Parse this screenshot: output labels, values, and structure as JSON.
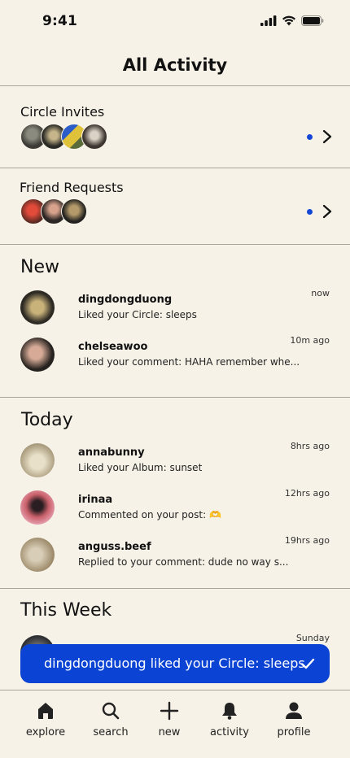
{
  "status_bar": {
    "time": "9:41"
  },
  "page_title": "All Activity",
  "circle_invites": {
    "label": "Circle Invites",
    "unread": true
  },
  "friend_requests": {
    "label": "Friend Requests",
    "unread": true
  },
  "sections": {
    "new": {
      "title": "New",
      "items": [
        {
          "user": "dingdongduong",
          "text": "Liked your Circle: sleeps",
          "time": "now"
        },
        {
          "user": "chelseawoo",
          "text": "Liked your comment: HAHA remember whe...",
          "time": "10m ago"
        }
      ]
    },
    "today": {
      "title": "Today",
      "items": [
        {
          "user": "annabunny",
          "text": "Liked your Album: sunset",
          "time": "8hrs ago"
        },
        {
          "user": "irinaa",
          "text": "Commented on your post: 🫶",
          "time": "12hrs ago"
        },
        {
          "user": "anguss.beef",
          "text": "Replied to your comment: dude no way s...",
          "time": "19hrs ago"
        }
      ]
    },
    "this_week": {
      "title": "This Week",
      "items": [
        {
          "user": "",
          "text": "",
          "time": "Sunday"
        }
      ]
    }
  },
  "toast": {
    "text": "dingdongduong liked your Circle: sleeps"
  },
  "tab_bar": {
    "items": [
      {
        "label": "explore",
        "icon": "home-icon"
      },
      {
        "label": "search",
        "icon": "search-icon"
      },
      {
        "label": "new",
        "icon": "plus-icon"
      },
      {
        "label": "activity",
        "icon": "bell-icon"
      },
      {
        "label": "profile",
        "icon": "person-icon"
      }
    ]
  },
  "colors": {
    "background": "#f7f2e7",
    "accent": "#0b44d4",
    "unread_dot": "#1447d6"
  }
}
